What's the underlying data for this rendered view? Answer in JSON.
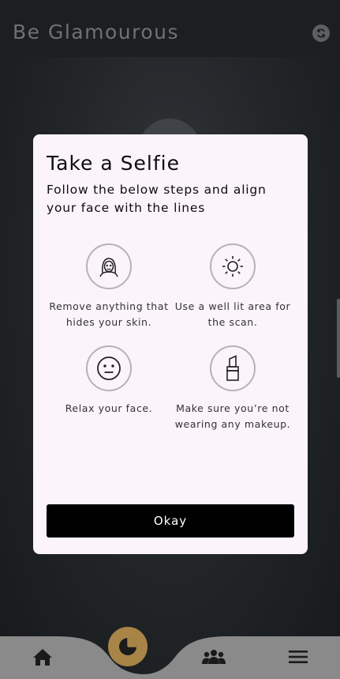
{
  "header": {
    "title": "Be Glamourous",
    "refresh_icon": "refresh-icon"
  },
  "modal": {
    "title": "Take a Selfie",
    "subtitle": "Follow the below steps and align your face with the lines",
    "steps": [
      {
        "icon": "face-icon",
        "text": "Remove anything that hides your skin."
      },
      {
        "icon": "sun-icon",
        "text": "Use a well lit area for the scan."
      },
      {
        "icon": "neutral-face-icon",
        "text": "Relax your face."
      },
      {
        "icon": "lipstick-icon",
        "text": "Make sure you’re not wearing any makeup."
      }
    ],
    "ok_label": "Okay"
  },
  "bottom_nav": {
    "items": [
      "home-icon",
      "pie-chart-icon",
      "group-icon",
      "menu-icon"
    ],
    "accent": "#a88547"
  },
  "colors": {
    "background": "#1b1d20",
    "modal_bg": "#fbf4fb",
    "button_bg": "#000000",
    "nav_bg": "#8a8a8a"
  }
}
